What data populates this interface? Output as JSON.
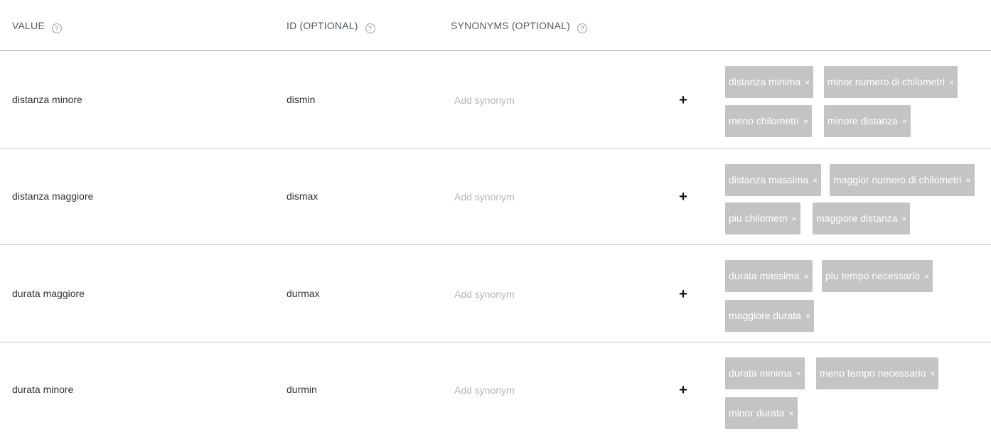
{
  "header": {
    "value_label": "VALUE",
    "id_label": "ID (OPTIONAL)",
    "synonyms_label": "SYNONYMS (OPTIONAL)",
    "help_glyph": "?"
  },
  "add_glyph": "+",
  "remove_glyph": "×",
  "rows": [
    {
      "value": "distanza minore",
      "id": "dismin",
      "synonym_placeholder": "Add synonym",
      "synonyms": [
        "distanza minima",
        "minor numero di chilometri",
        "meno chilometri",
        "minore distanza"
      ]
    },
    {
      "value": "distanza maggiore",
      "id": "dismax",
      "synonym_placeholder": "Add synonym",
      "synonyms": [
        "distanza massima",
        "maggior numero di chilometri",
        "piu chilometri",
        "maggiore distanza"
      ]
    },
    {
      "value": "durata maggiore",
      "id": "durmax",
      "synonym_placeholder": "Add synonym",
      "synonyms": [
        "durata massima",
        "piu tempo necessario",
        "maggiore durata"
      ]
    },
    {
      "value": "durata minore",
      "id": "durmin",
      "synonym_placeholder": "Add synonym",
      "synonyms": [
        "durata minima",
        "meno tempo necessario",
        "minor durata"
      ]
    }
  ]
}
